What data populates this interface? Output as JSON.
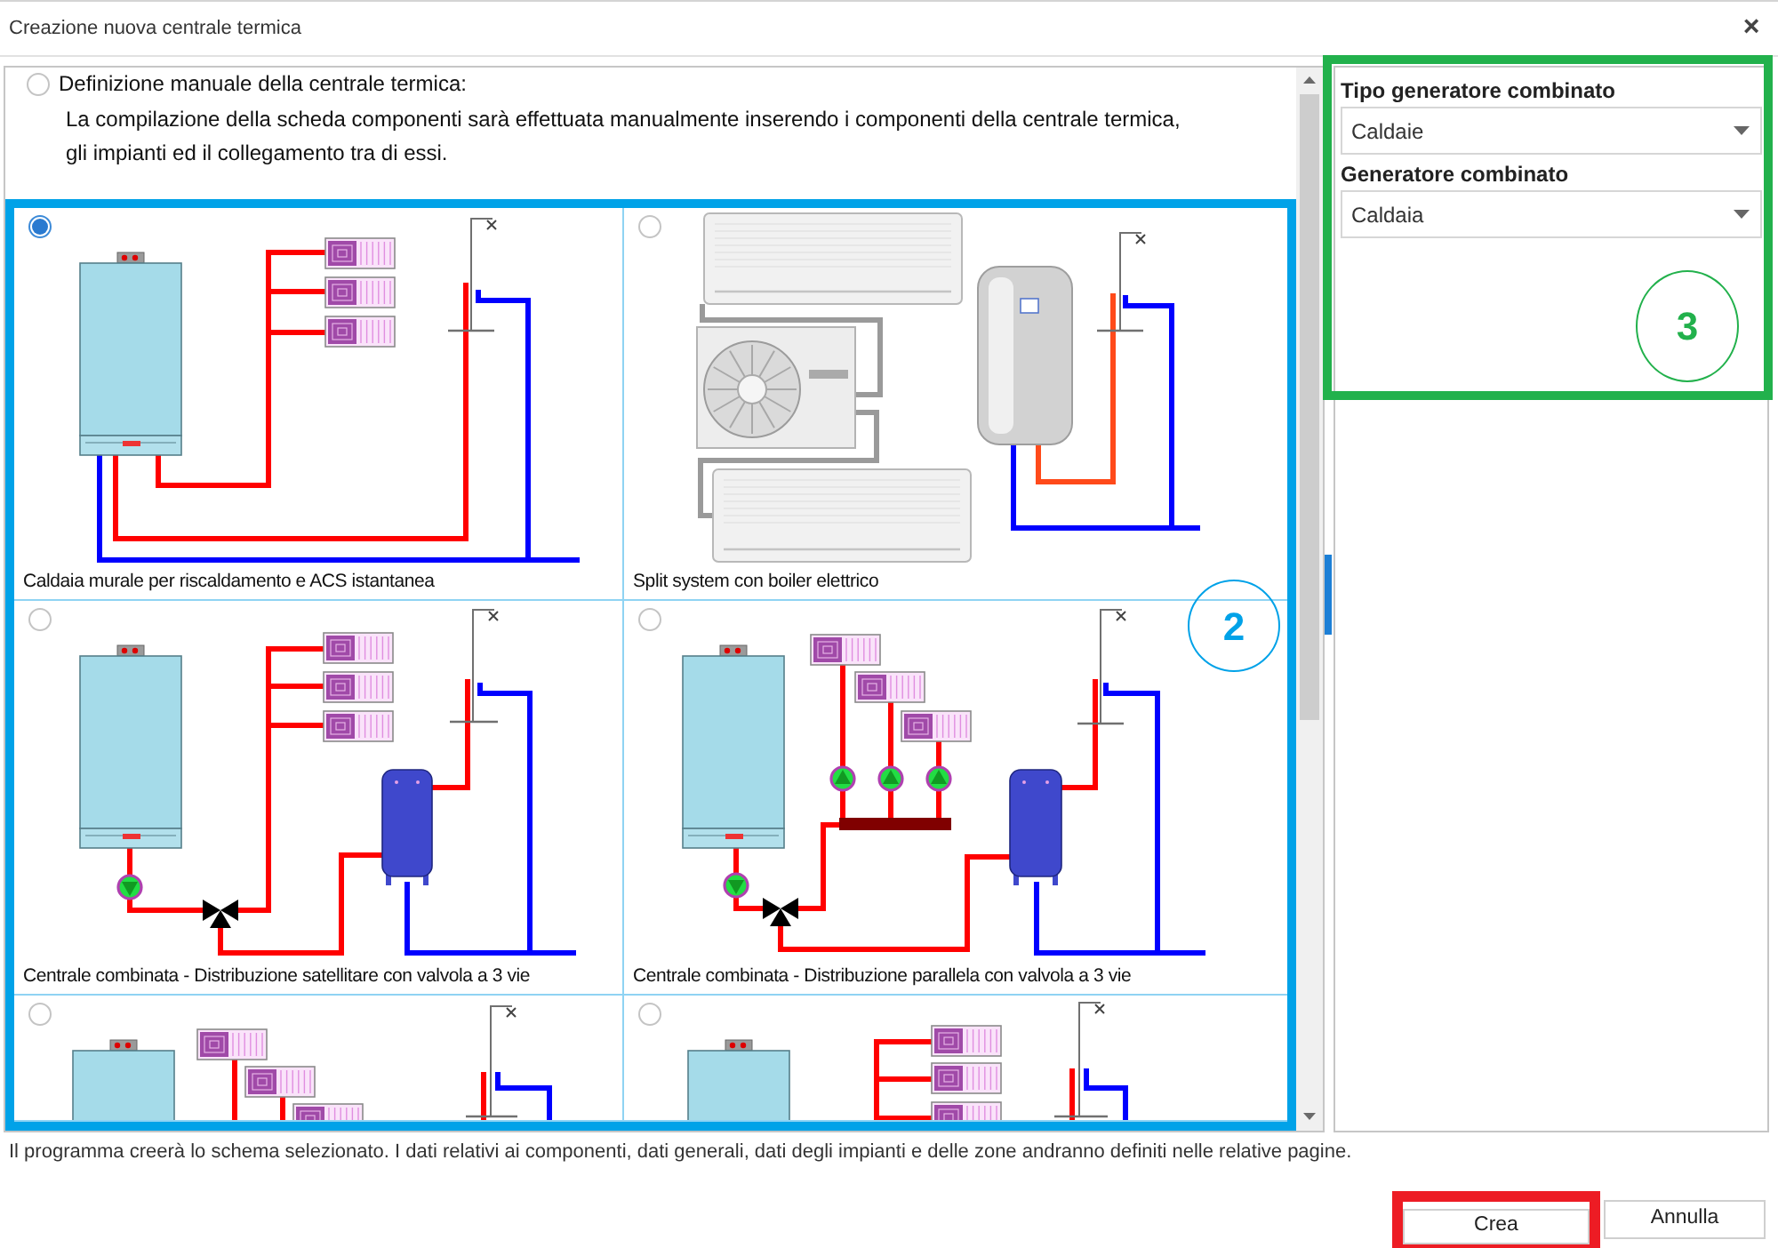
{
  "window": {
    "title": "Creazione nuova centrale termica",
    "close_label": "×"
  },
  "manual_option": {
    "label": "Definizione manuale della centrale termica:",
    "selected": false,
    "description": "La compilazione della scheda componenti sarà effettuata manualmente inserendo i componenti della centrale termica, gli impianti ed il collegamento tra di essi."
  },
  "schemes_panel": {
    "frame": {
      "color": "#00a2e8",
      "number": "2"
    },
    "items": [
      {
        "kind": "wall_boiler",
        "caption": "Caldaia murale per riscaldamento e ACS istantanea",
        "selected": true
      },
      {
        "kind": "split_system",
        "caption": "Split system con boiler elettrico",
        "selected": false
      },
      {
        "kind": "combined_satellite",
        "caption": "Centrale combinata - Distribuzione satellitare con valvola a 3 vie",
        "selected": false
      },
      {
        "kind": "combined_parallel",
        "caption": "Centrale combinata - Distribuzione parallela con valvola a 3 vie",
        "selected": false
      },
      {
        "kind": "staggered_partial",
        "selected": false
      },
      {
        "kind": "stacked_partial",
        "selected": false
      }
    ]
  },
  "generator_panel": {
    "frame": {
      "color": "#22b14c",
      "number": "3"
    },
    "fields": [
      {
        "label": "Tipo generatore combinato",
        "value": "Caldaie"
      },
      {
        "label": "Generatore combinato",
        "value": "Caldaia"
      }
    ]
  },
  "footer_note": "Il programma creerà lo schema selezionato. I dati relativi ai componenti, dati generali, dati degli impianti e delle zone andranno definiti nelle relative pagine.",
  "buttons": [
    {
      "label": "Crea",
      "color": "#ed1c24"
    },
    {
      "label": "Annulla"
    }
  ]
}
